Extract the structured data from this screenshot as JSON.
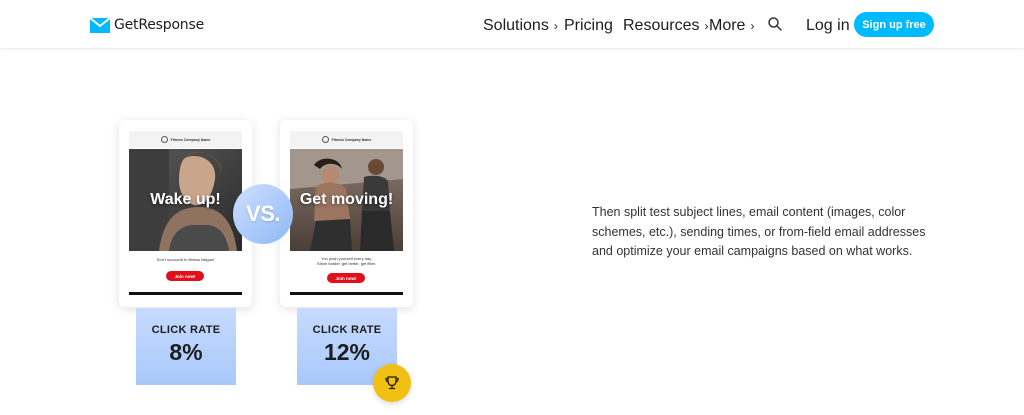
{
  "header": {
    "brand": "GetResponse",
    "nav": [
      {
        "label": "Solutions",
        "has_chevron": true
      },
      {
        "label": "Pricing",
        "has_chevron": false
      },
      {
        "label": "Resources",
        "has_chevron": true
      },
      {
        "label": "More",
        "has_chevron": true
      }
    ],
    "chevron": "›",
    "search_icon": "search-icon",
    "login": "Log in",
    "signup": "Sign up free"
  },
  "cards": [
    {
      "company": "Fitness Company Name",
      "headline": "Wake up!",
      "body_lines": [
        "Don't succumb to fitness fatigue!"
      ],
      "button": "Join now!",
      "rate_label": "CLICK RATE",
      "rate_value": "8%"
    },
    {
      "company": "Fitness Company Name",
      "headline": "Get moving!",
      "body_lines": [
        "You push yourself every day.",
        "Strive harder, get better, get fitter."
      ],
      "button": "Join now!",
      "rate_label": "CLICK RATE",
      "rate_value": "12%"
    }
  ],
  "vs_label": "VS.",
  "winner_icon": "trophy-icon",
  "description": "Then split test subject lines, email content (images, color schemes, etc.), sending times, or from-field email addresses and optimize your email campaigns based on what works.",
  "colors": {
    "accent": "#00baff",
    "join_button": "#e0101a",
    "trophy": "#f2c012",
    "rate_panel": "#b3cffc"
  }
}
